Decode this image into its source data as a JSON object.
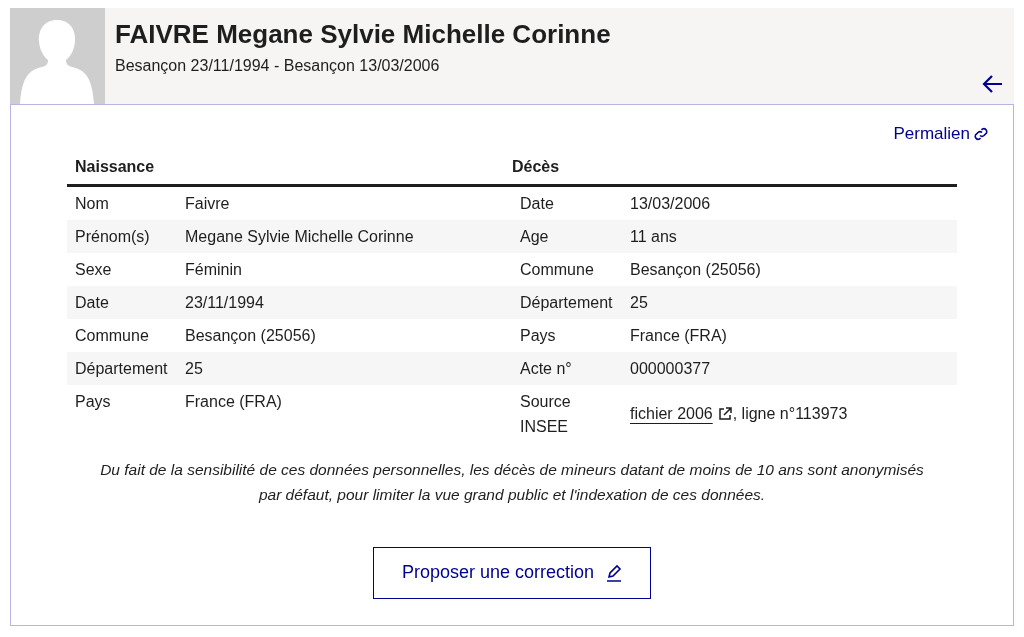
{
  "header": {
    "name": "FAIVRE Megane Sylvie Michelle Corinne",
    "subtitle": "Besançon 23/11/1994 - Besançon 13/03/2006"
  },
  "permalink": "Permalien",
  "table": {
    "columns": [
      "Naissance",
      "Décès"
    ],
    "rows": [
      {
        "birth_label": "Nom",
        "birth_value": "Faivre",
        "death_label": "Date",
        "death_value": "13/03/2006"
      },
      {
        "birth_label": "Prénom(s)",
        "birth_value": "Megane Sylvie Michelle Corinne",
        "death_label": "Age",
        "death_value": "11 ans"
      },
      {
        "birth_label": "Sexe",
        "birth_value": "Féminin",
        "death_label": "Commune",
        "death_value": "Besançon (25056)"
      },
      {
        "birth_label": "Date",
        "birth_value": "23/11/1994",
        "death_label": "Département",
        "death_value": "25"
      },
      {
        "birth_label": "Commune",
        "birth_value": "Besançon (25056)",
        "death_label": "Pays",
        "death_value": "France (FRA)"
      },
      {
        "birth_label": "Département",
        "birth_value": "25",
        "death_label": "Acte n°",
        "death_value": "000000377"
      },
      {
        "birth_label": "Pays",
        "birth_value": "France (FRA)",
        "death_label": "Source INSEE",
        "death_link": "fichier 2006",
        "death_value": ", ligne n°113973"
      }
    ]
  },
  "notice": "Du fait de la sensibilité de ces données personnelles, les décès de mineurs datant de moins de 10 ans sont anonymisés par défaut, pour limiter la vue grand public et l'indexation de ces données.",
  "button": "Proposer une correction"
}
